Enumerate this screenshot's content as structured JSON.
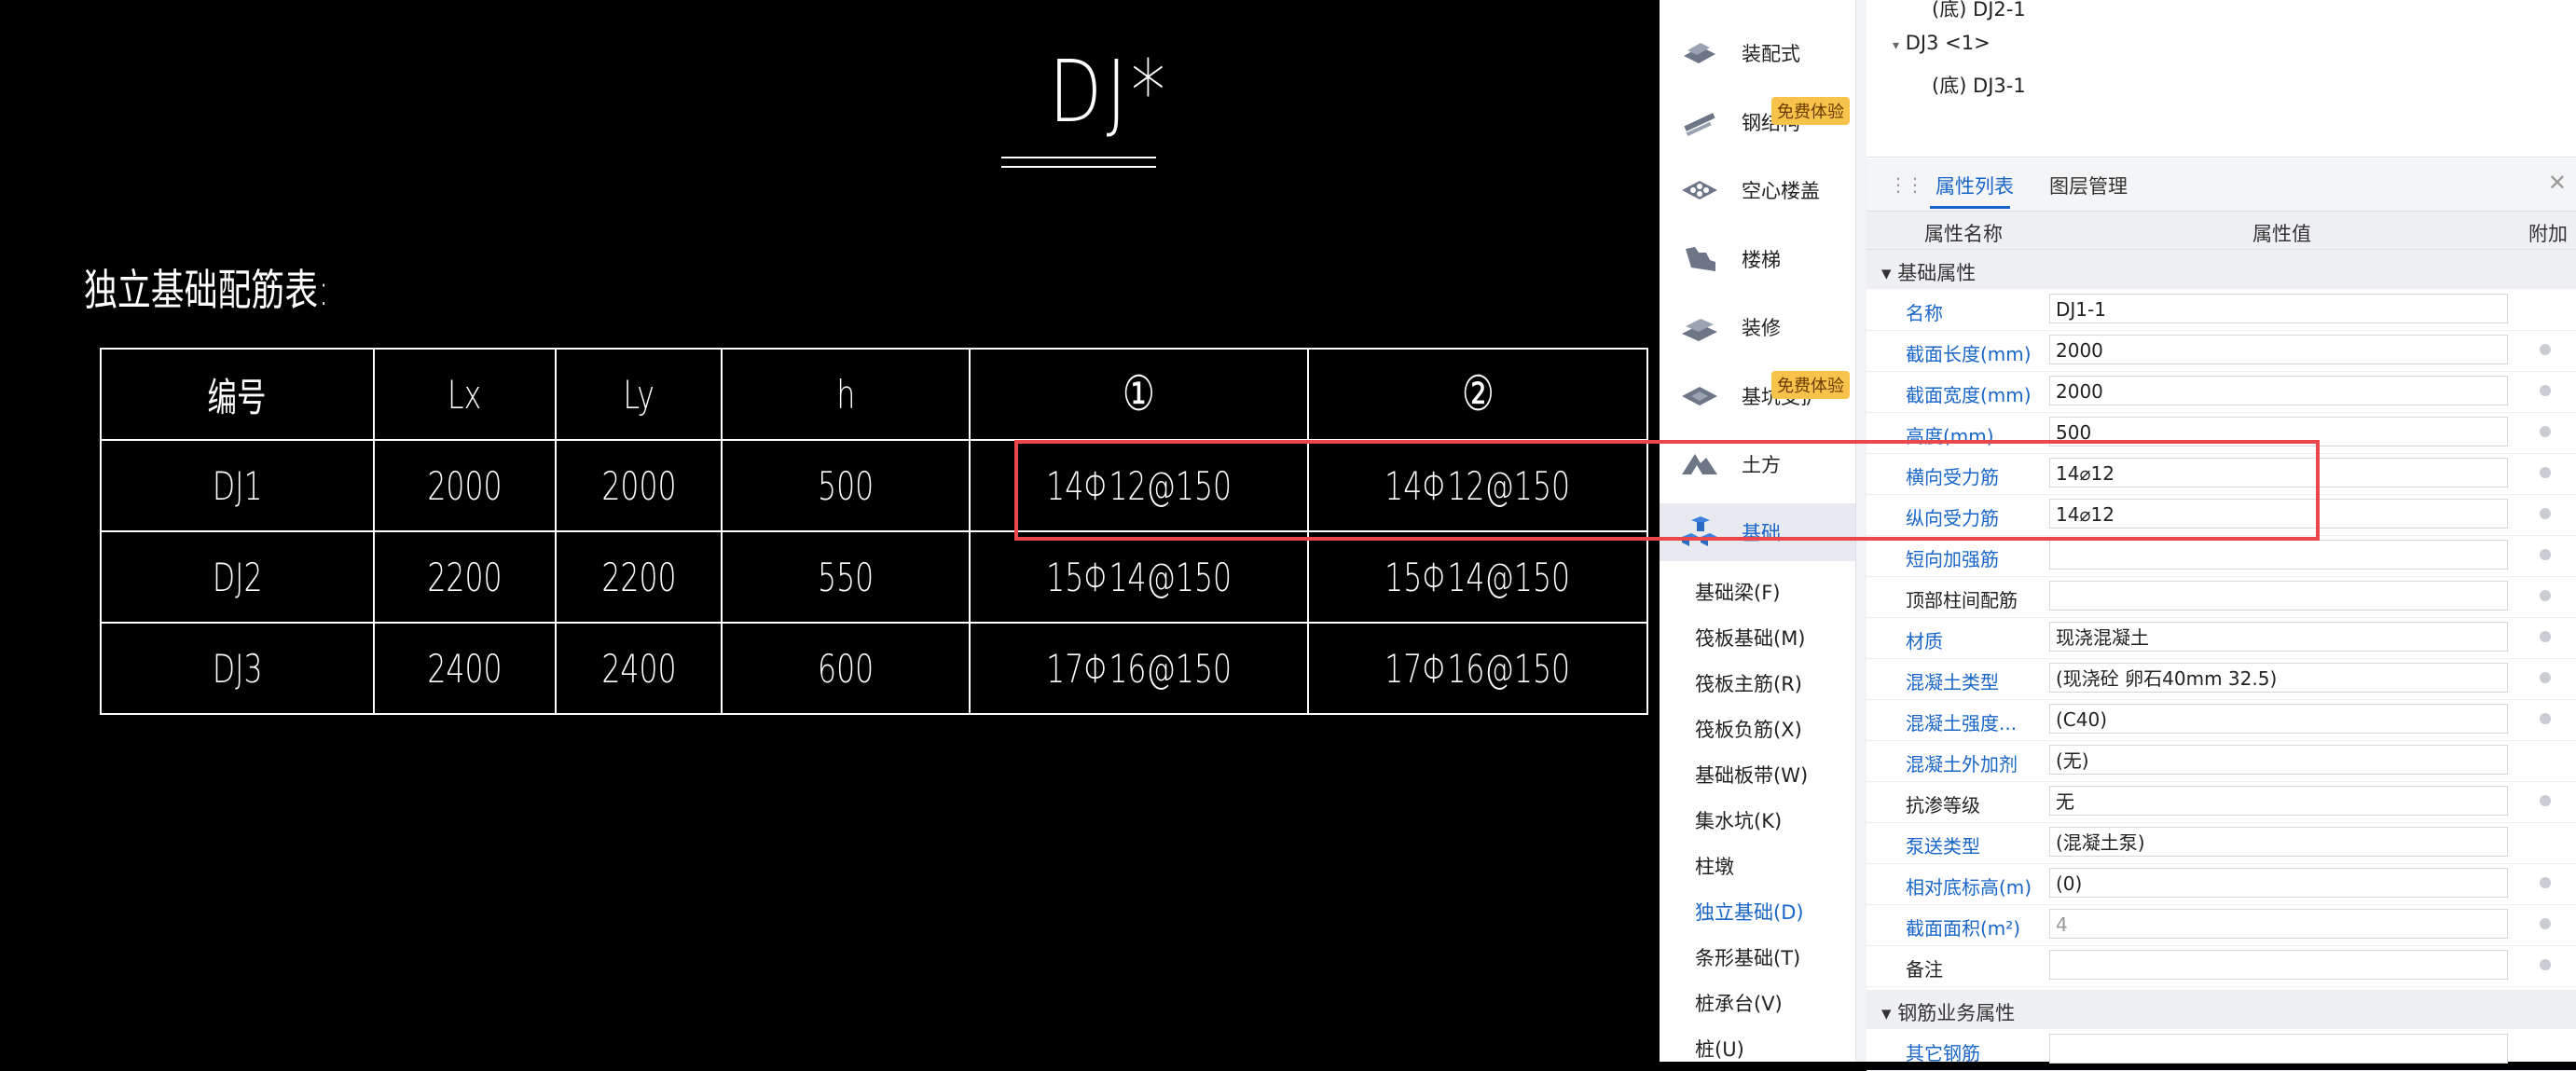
{
  "cad": {
    "title": "DJ*",
    "table_caption": "独立基础配筋表:",
    "table": {
      "headers": [
        "编号",
        "Lx",
        "Ly",
        "h",
        "①",
        "②"
      ],
      "rows": [
        [
          "DJ1",
          "2000",
          "2000",
          "500",
          "14Φ12@150",
          "14Φ12@150"
        ],
        [
          "DJ2",
          "2200",
          "2200",
          "550",
          "15Φ14@150",
          "15Φ14@150"
        ],
        [
          "DJ3",
          "2400",
          "2400",
          "600",
          "17Φ16@150",
          "17Φ16@150"
        ]
      ]
    }
  },
  "nav": {
    "categories": [
      {
        "label": "装配式",
        "icon": "prefab-icon"
      },
      {
        "label": "钢结构",
        "icon": "steel-structure-icon",
        "badge": "免费体验"
      },
      {
        "label": "空心楼盖",
        "icon": "hollow-floor-icon"
      },
      {
        "label": "楼梯",
        "icon": "stair-icon"
      },
      {
        "label": "装修",
        "icon": "decoration-icon"
      },
      {
        "label": "基坑支护",
        "icon": "foundation-pit-icon",
        "badge": "免费体验"
      },
      {
        "label": "土方",
        "icon": "earthwork-icon"
      },
      {
        "label": "基础",
        "icon": "foundation-icon"
      }
    ],
    "sub_items": [
      "基础梁(F)",
      "筏板基础(M)",
      "筏板主筋(R)",
      "筏板负筋(X)",
      "基础板带(W)",
      "集水坑(K)",
      "柱墩",
      "独立基础(D)",
      "条形基础(T)",
      "桩承台(V)",
      "桩(U)"
    ],
    "active_sub": "独立基础(D)"
  },
  "tree": {
    "items": [
      "(底) DJ2-1",
      "DJ3 <1>",
      "(底) DJ3-1"
    ]
  },
  "panel": {
    "tabs": [
      "属性列表",
      "图层管理"
    ],
    "header": {
      "name": "属性名称",
      "value": "属性值",
      "extra": "附加"
    },
    "group1": "基础属性",
    "props": [
      {
        "name": "名称",
        "value": "DJ1-1",
        "style": "blue",
        "chk": false
      },
      {
        "name": "截面长度(mm)",
        "value": "2000",
        "style": "blue",
        "chk": true
      },
      {
        "name": "截面宽度(mm)",
        "value": "2000",
        "style": "blue",
        "chk": true
      },
      {
        "name": "高度(mm)",
        "value": "500",
        "style": "blue",
        "chk": true
      },
      {
        "name": "横向受力筋",
        "value": "14⌀12",
        "style": "blue",
        "chk": true
      },
      {
        "name": "纵向受力筋",
        "value": "14⌀12",
        "style": "blue",
        "chk": true
      },
      {
        "name": "短向加强筋",
        "value": "",
        "style": "blue",
        "chk": true
      },
      {
        "name": "顶部柱间配筋",
        "value": "",
        "style": "black",
        "chk": true
      },
      {
        "name": "材质",
        "value": "现浇混凝土",
        "style": "blue",
        "chk": true
      },
      {
        "name": "混凝土类型",
        "value": "(现浇砼 卵石40mm 32.5)",
        "style": "blue",
        "chk": true
      },
      {
        "name": "混凝土强度...",
        "value": "(C40)",
        "style": "blue",
        "chk": true
      },
      {
        "name": "混凝土外加剂",
        "value": "(无)",
        "style": "blue",
        "chk": false
      },
      {
        "name": "抗渗等级",
        "value": "无",
        "style": "black",
        "chk": true
      },
      {
        "name": "泵送类型",
        "value": "(混凝土泵)",
        "style": "blue",
        "chk": false
      },
      {
        "name": "相对底标高(m)",
        "value": "(0)",
        "style": "blue",
        "chk": true
      },
      {
        "name": "截面面积(m²)",
        "value": "4",
        "style": "blue",
        "chk": true,
        "gray": true
      },
      {
        "name": "备注",
        "value": "",
        "style": "black",
        "chk": true
      }
    ],
    "group2": "钢筋业务属性",
    "props2": [
      {
        "name": "其它钢筋",
        "value": "",
        "style": "blue",
        "chk": false
      }
    ]
  }
}
